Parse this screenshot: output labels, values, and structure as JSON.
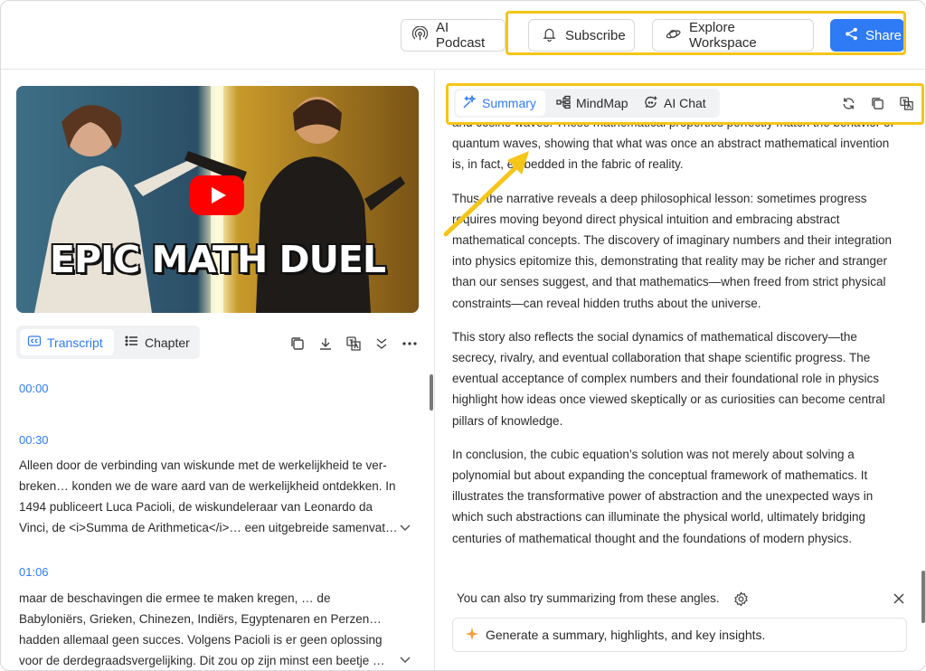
{
  "header": {
    "podcast_label": "AI Podcast",
    "subscribe_label": "Subscribe",
    "explore_label": "Explore Workspace",
    "share_label": "Share"
  },
  "video": {
    "thumbnail_title": "EPIC MATH DUEL"
  },
  "left_tabs": {
    "transcript_label": "Transcript",
    "chapter_label": "Chapter"
  },
  "transcript": [
    {
      "time": "00:00",
      "text": ""
    },
    {
      "time": "00:30",
      "text": "Alleen door de verbinding van wiskunde met de werkelijkheid te ver-breken… konden we de ware aard van de werkelijkheid ontdekken. In 1494 publiceert Luca Pacioli, de wiskundeleraar van Leonardo da Vinci, de <i>Summa de Arithmetica</i>… een uitgebreide samenvat…"
    },
    {
      "time": "01:06",
      "text": "maar de beschavingen die ermee te maken kregen, … de Babyloniërs, Grieken, Chinezen, Indiërs, Egyptenaren en Perzen… hadden allemaal geen succes. Volgens Pacioli is er geen oplossing voor de derdegraadsvergelijking. Dit zou op zijn minst een beetje …"
    }
  ],
  "right_tabs": {
    "summary_label": "Summary",
    "mindmap_label": "MindMap",
    "aichat_label": "AI Chat"
  },
  "summary": {
    "p1": "and cosine waves. These mathematical properties perfectly match the behavior of quantum waves, showing that what was once an abstract mathematical invention is, in fact, embedded in the fabric of reality.",
    "p2": "Thus, the narrative reveals a deep philosophical lesson: sometimes progress requires moving beyond direct physical intuition and embracing abstract mathematical concepts. The discovery of imaginary numbers and their integration into physics epitomize this, demonstrating that reality may be richer and stranger than our senses suggest, and that mathematics—when freed from strict physical constraints—can reveal hidden truths about the universe.",
    "p3": "This story also reflects the social dynamics of mathematical discovery—the secrecy, rivalry, and eventual collaboration that shape scientific progress. The eventual acceptance of complex numbers and their foundational role in physics highlight how ideas once viewed skeptically or as curiosities can become central pillars of knowledge.",
    "p4": "In conclusion, the cubic equation’s solution was not merely about solving a polynomial but about expanding the conceptual framework of mathematics. It illustrates the transformative power of abstraction and the unexpected ways in which such abstractions can illuminate the physical world, ultimately bridging centuries of mathematical thought and the foundations of modern physics."
  },
  "suggestion": {
    "prompt_text": "You can also try summarizing from these angles.",
    "generate_label": "Generate a summary, highlights, and key insights."
  },
  "colors": {
    "accent": "#2f7bf6",
    "highlight": "#f5c518"
  }
}
